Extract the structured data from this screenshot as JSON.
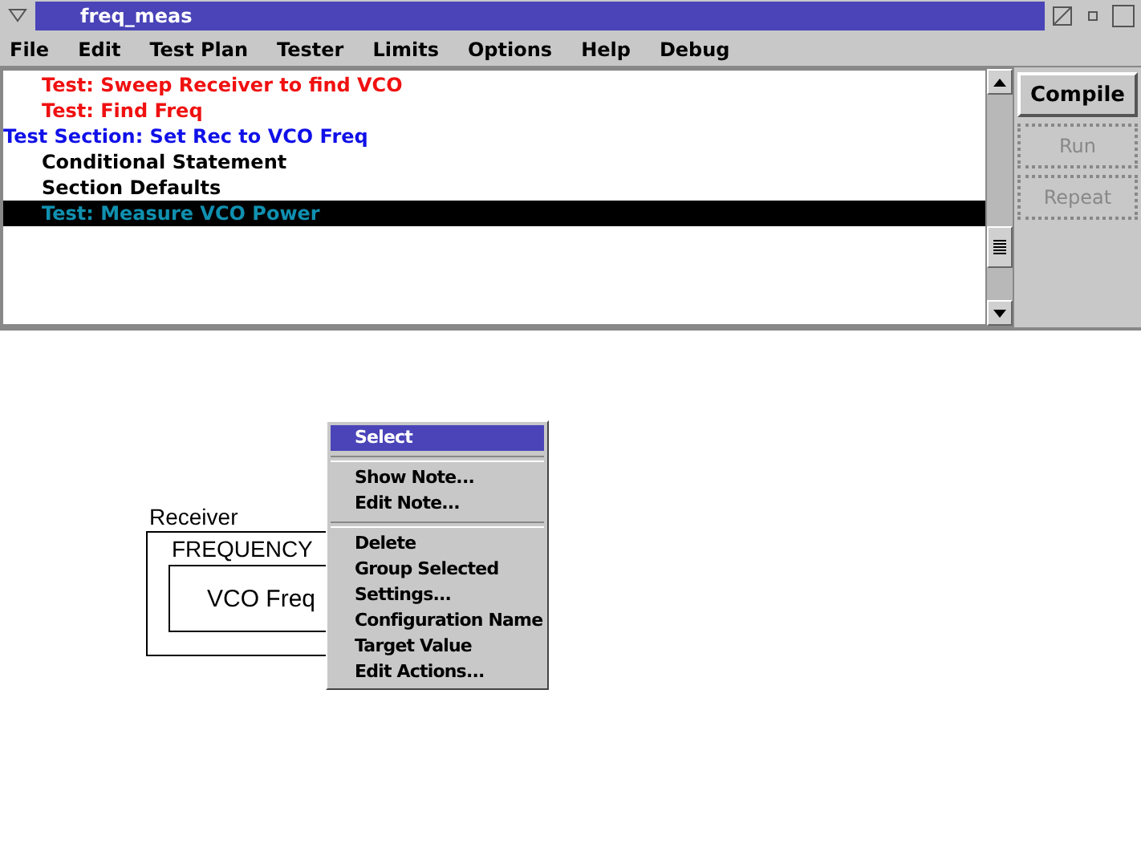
{
  "window": {
    "title": "freq_meas"
  },
  "menu": [
    "File",
    "Edit",
    "Test Plan",
    "Tester",
    "Limits",
    "Options",
    "Help",
    "Debug"
  ],
  "plan_items": [
    {
      "kind": "test",
      "label": "Test: Sweep Receiver to find VCO",
      "selected": false
    },
    {
      "kind": "test",
      "label": "Test: Find Freq",
      "selected": false
    },
    {
      "kind": "section",
      "label": "Test Section: Set Rec to VCO Freq",
      "selected": false
    },
    {
      "kind": "statement",
      "label": "Conditional Statement",
      "selected": false
    },
    {
      "kind": "statement",
      "label": "Section Defaults",
      "selected": false
    },
    {
      "kind": "test",
      "label": "Test: Measure VCO Power",
      "selected": true
    }
  ],
  "buttons": [
    {
      "label": "Compile",
      "disabled": false
    },
    {
      "label": "Run",
      "disabled": true
    },
    {
      "label": "Repeat",
      "disabled": true
    }
  ],
  "canvas": {
    "group_label": "Receiver",
    "block_label": "FREQUENCY",
    "node_label": "VCO Freq"
  },
  "context_menu": [
    {
      "label": "Select",
      "selected": true,
      "separator_after": true
    },
    {
      "label": "Show Note...",
      "selected": false,
      "separator_after": false
    },
    {
      "label": "Edit Note...",
      "selected": false,
      "separator_after": true
    },
    {
      "label": "Delete",
      "selected": false,
      "separator_after": false
    },
    {
      "label": "Group Selected",
      "selected": false,
      "separator_after": false
    },
    {
      "label": "Settings...",
      "selected": false,
      "separator_after": false
    },
    {
      "label": "Configuration Name",
      "selected": false,
      "separator_after": false
    },
    {
      "label": "Target Value",
      "selected": false,
      "separator_after": false
    },
    {
      "label": "Edit Actions...",
      "selected": false,
      "separator_after": false
    }
  ]
}
